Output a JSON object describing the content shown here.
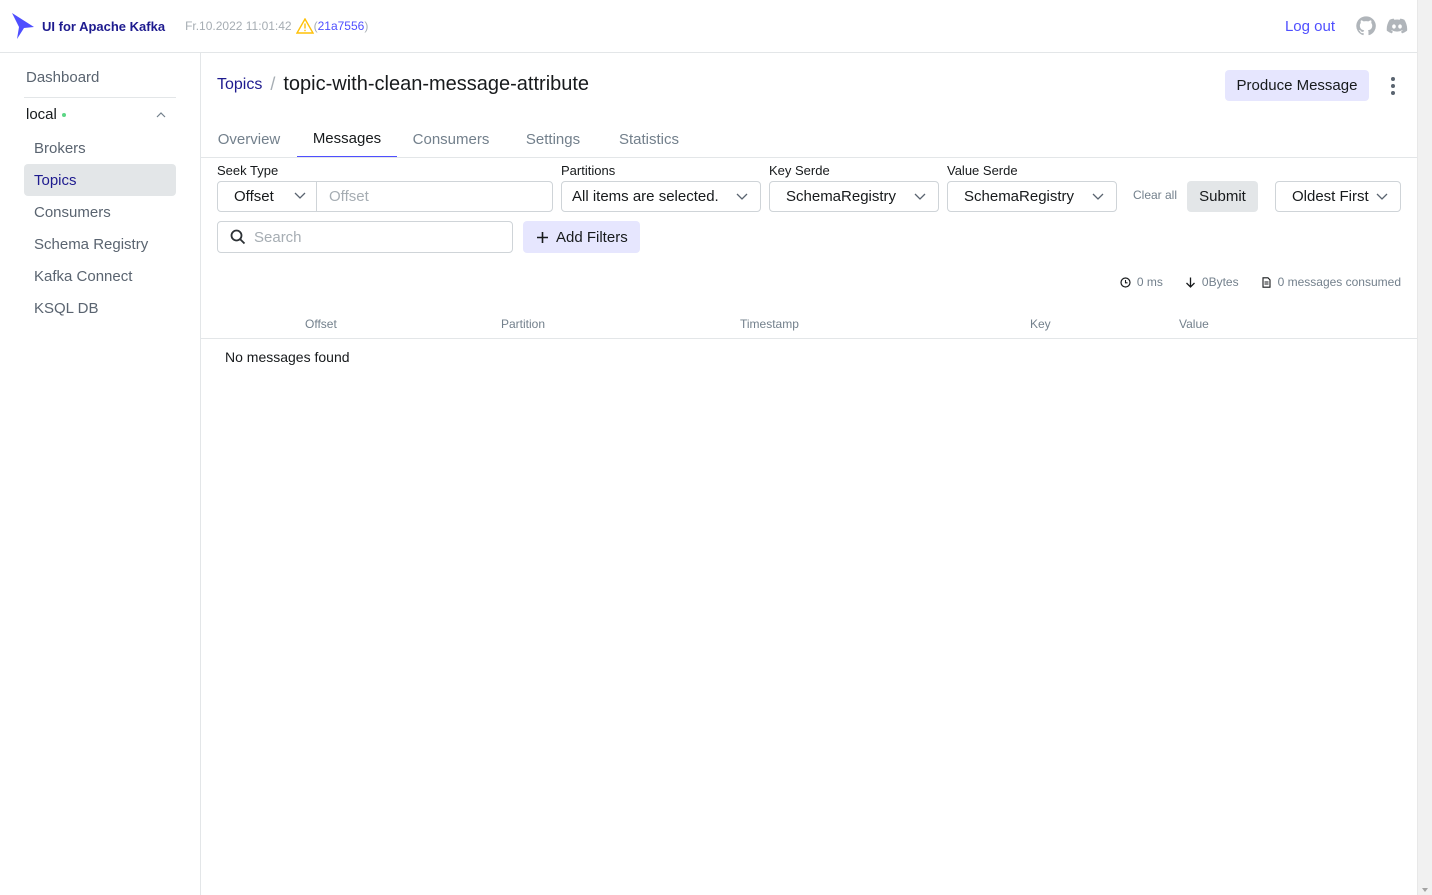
{
  "app": {
    "brand_name": "UI for Apache Kafka",
    "build_date": "Fr.10.2022 11:01:42",
    "commit_open": "(",
    "commit_hash": "21a7556",
    "commit_close": ")",
    "logout": "Log out"
  },
  "sidebar": {
    "dashboard": "Dashboard",
    "cluster_name": "local",
    "items": [
      {
        "label": "Brokers"
      },
      {
        "label": "Topics"
      },
      {
        "label": "Consumers"
      },
      {
        "label": "Schema Registry"
      },
      {
        "label": "Kafka Connect"
      },
      {
        "label": "KSQL DB"
      }
    ]
  },
  "header": {
    "breadcrumb_parent": "Topics",
    "breadcrumb_sep": "/",
    "title": "topic-with-clean-message-attribute",
    "produce_button": "Produce Message"
  },
  "tabs": [
    {
      "label": "Overview"
    },
    {
      "label": "Messages"
    },
    {
      "label": "Consumers"
    },
    {
      "label": "Settings"
    },
    {
      "label": "Statistics"
    }
  ],
  "filters": {
    "seek_type_label": "Seek Type",
    "seek_type_value": "Offset",
    "offset_placeholder": "Offset",
    "partitions_label": "Partitions",
    "partitions_value": "All items are selected.",
    "key_serde_label": "Key Serde",
    "key_serde_value": "SchemaRegistry",
    "value_serde_label": "Value Serde",
    "value_serde_value": "SchemaRegistry",
    "clear_all": "Clear all",
    "submit": "Submit",
    "order_value": "Oldest First",
    "search_placeholder": "Search",
    "add_filters": "Add Filters"
  },
  "stats": {
    "elapsed": "0 ms",
    "bytes": "0Bytes",
    "consumed": "0 messages consumed"
  },
  "table": {
    "columns": [
      "Offset",
      "Partition",
      "Timestamp",
      "Key",
      "Value"
    ],
    "empty_message": "No messages found"
  },
  "colors": {
    "accent": "#4f4fff",
    "brand": "#1e1b8f",
    "active_tab_underline": "#4f4fff",
    "online_dot": "#5cd685",
    "warning": "#ffc107"
  }
}
